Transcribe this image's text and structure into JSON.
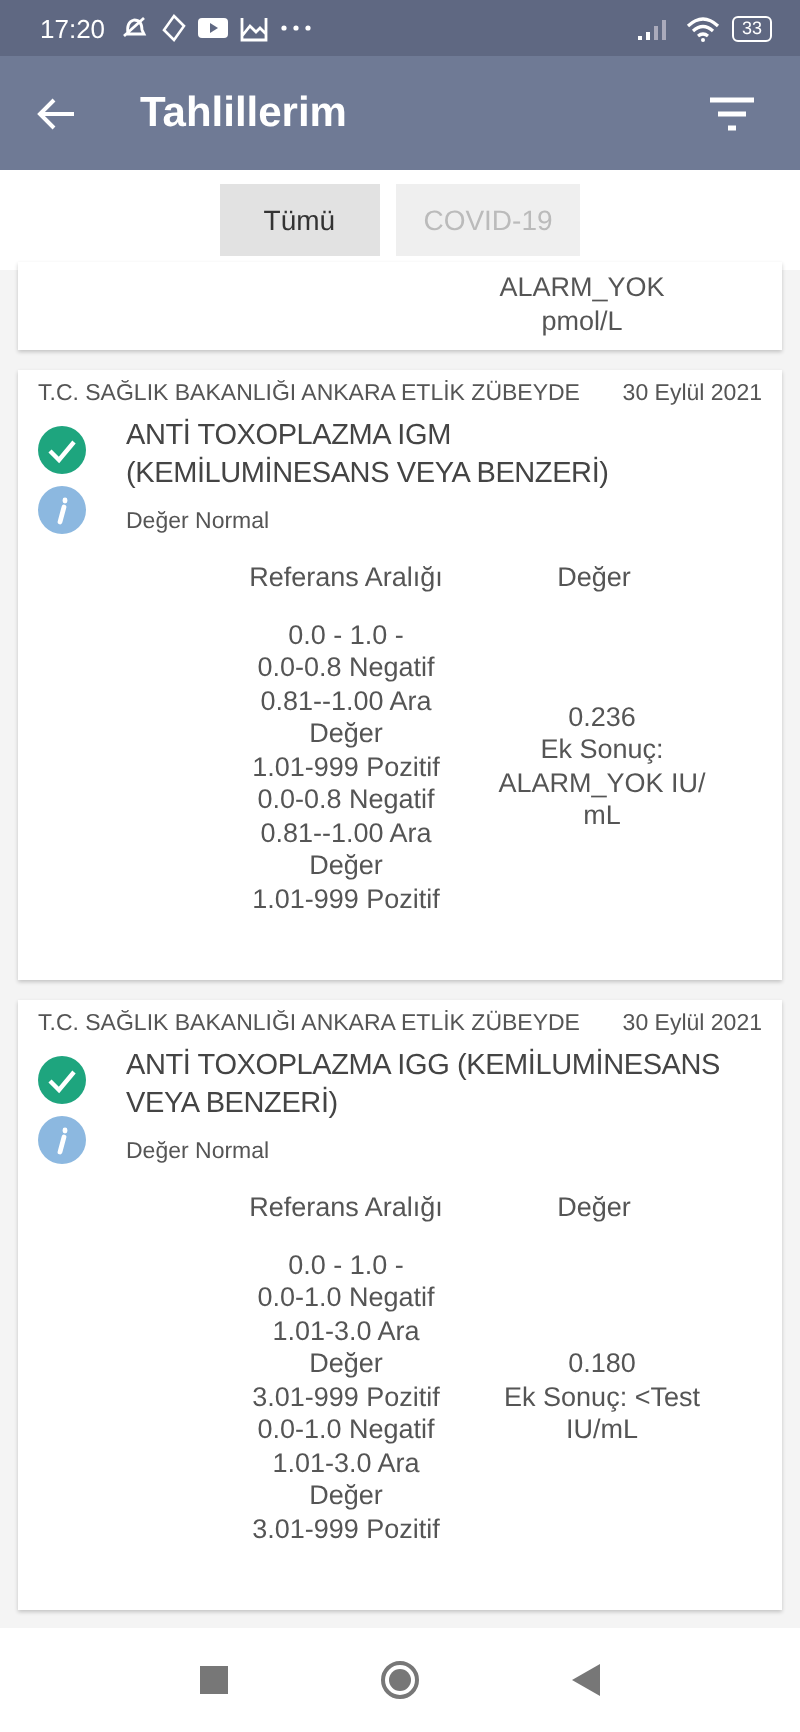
{
  "status_bar": {
    "time": "17:20",
    "battery": "33"
  },
  "app_bar": {
    "title": "Tahlillerim"
  },
  "tabs": [
    {
      "label": "Tümü",
      "selected": true
    },
    {
      "label": "COVID-19",
      "selected": false
    }
  ],
  "partial_card": {
    "value": "ALARM_YOK\npmol/L"
  },
  "results": [
    {
      "institution": "T.C. SAĞLIK BAKANLIĞI ANKARA ETLİK ZÜBEYDE",
      "date": "30 Eylül 2021",
      "test": "ANTİ TOXOPLAZMA IGM\n(KEMİLUMİNESANS VEYA BENZERİ)",
      "normal": true,
      "status": "Değer Normal",
      "range_header": "Referans Aralığı",
      "value_header": "Değer",
      "range": "0.0 - 1.0  -\n0.0-0.8 Negatif\n0.81--1.00 Ara\nDeğer\n1.01-999 Pozitif\n0.0-0.8 Negatif\n0.81--1.00 Ara\nDeğer\n1.01-999 Pozitif",
      "value": "0.236\nEk Sonuç:\nALARM_YOK IU/\nmL"
    },
    {
      "institution": "T.C. SAĞLIK BAKANLIĞI ANKARA ETLİK ZÜBEYDE",
      "date": "30 Eylül 2021",
      "test": "ANTİ TOXOPLAZMA IGG (KEMİLUMİNESANS\nVEYA BENZERİ)",
      "normal": true,
      "status": "Değer Normal",
      "range_header": "Referans Aralığı",
      "value_header": "Değer",
      "range": "0.0 - 1.0  -\n0.0-1.0 Negatif\n1.01-3.0 Ara\nDeğer\n3.01-999 Pozitif\n0.0-1.0 Negatif\n1.01-3.0 Ara\nDeğer\n3.01-999 Pozitif",
      "value": "0.180\nEk Sonuç: <Test\nIU/mL"
    }
  ]
}
